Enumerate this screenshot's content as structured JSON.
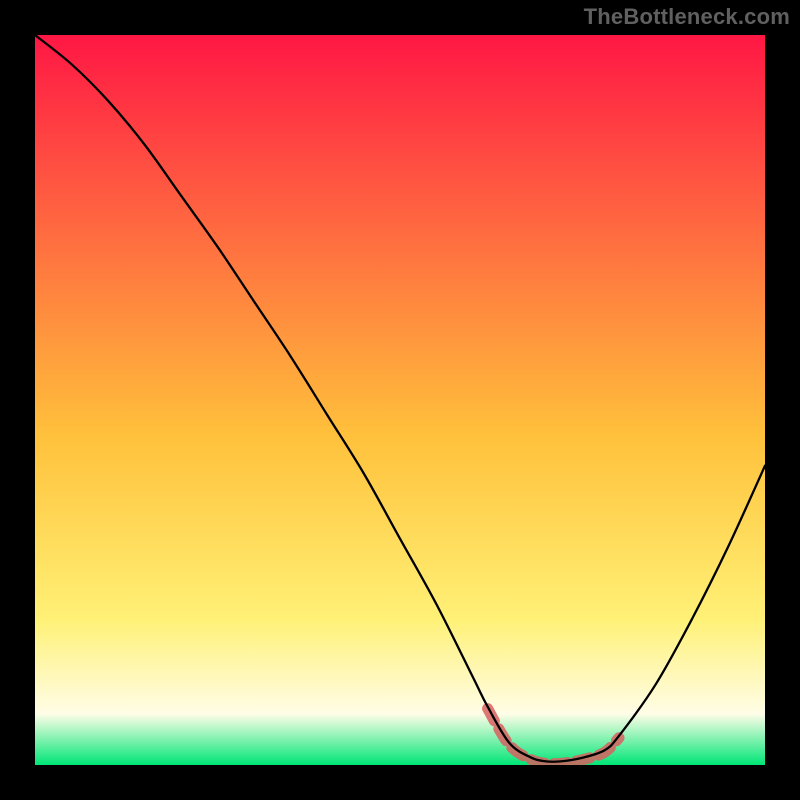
{
  "watermark": "TheBottleneck.com",
  "colors": {
    "gradient_top": "#ff1744",
    "gradient_mid_upper": "#ff6e40",
    "gradient_mid": "#ffc13b",
    "gradient_mid_lower": "#fff176",
    "gradient_low": "#fffde7",
    "gradient_bottom": "#00e676",
    "curve": "#000000",
    "highlight": "#d86060",
    "frame": "#000000"
  },
  "chart_data": {
    "type": "line",
    "title": "",
    "xlabel": "",
    "ylabel": "",
    "xlim": [
      0,
      100
    ],
    "ylim": [
      0,
      100
    ],
    "series": [
      {
        "name": "bottleneck-curve",
        "x": [
          0,
          5,
          10,
          15,
          20,
          25,
          30,
          35,
          40,
          45,
          50,
          55,
          60,
          62,
          65,
          68,
          70,
          72,
          75,
          78,
          80,
          85,
          90,
          95,
          100
        ],
        "y": [
          100,
          96,
          91,
          85,
          78,
          71,
          63.5,
          56,
          48,
          40,
          31,
          22,
          12,
          8,
          3,
          1,
          0.5,
          0.5,
          1,
          2,
          4,
          11,
          20,
          30,
          41
        ]
      }
    ],
    "annotations": [
      {
        "name": "optimal-range-highlight",
        "x_start": 62,
        "x_end": 80,
        "style": "red-dash-underline"
      }
    ]
  }
}
